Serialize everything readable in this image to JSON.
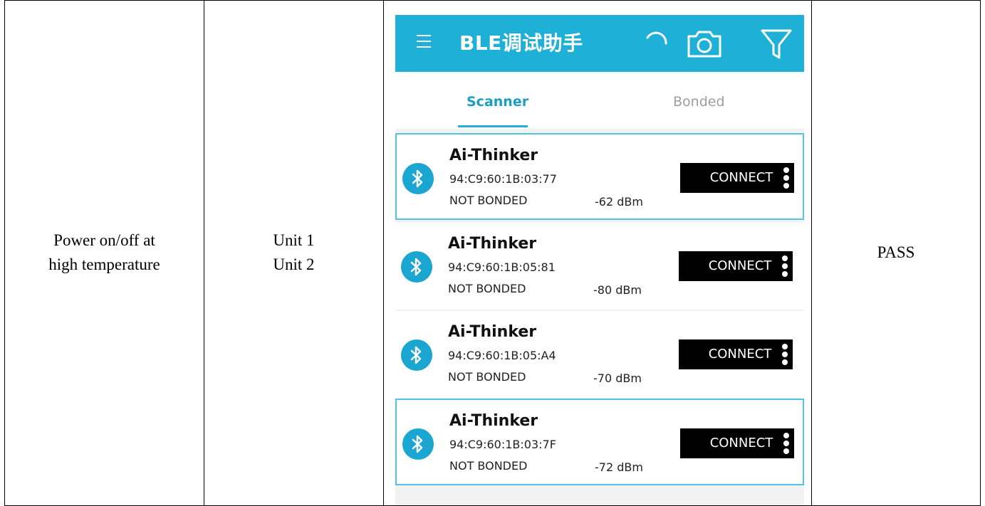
{
  "table": {
    "test_item": [
      "Power on/off at",
      "high temperature"
    ],
    "units": [
      "Unit 1",
      "Unit 2"
    ],
    "result": "PASS"
  },
  "app": {
    "title": "BLE调试助手",
    "header_icons": [
      "menu-icon",
      "refresh-icon",
      "camera-icon",
      "filter-icon"
    ],
    "accent_color": "#1fb0d7",
    "tabs": [
      {
        "label": "Scanner",
        "active": true
      },
      {
        "label": "Bonded",
        "active": false
      }
    ],
    "devices": [
      {
        "name": "Ai-Thinker",
        "mac": "94:C9:60:1B:03:77",
        "bond": "NOT BONDED",
        "rssi": "-62 dBm",
        "action": "CONNECT",
        "selected": true
      },
      {
        "name": "Ai-Thinker",
        "mac": "94:C9:60:1B:05:81",
        "bond": "NOT BONDED",
        "rssi": "-80 dBm",
        "action": "CONNECT",
        "selected": false
      },
      {
        "name": "Ai-Thinker",
        "mac": "94:C9:60:1B:05:A4",
        "bond": "NOT BONDED",
        "rssi": "-70 dBm",
        "action": "CONNECT",
        "selected": false
      },
      {
        "name": "Ai-Thinker",
        "mac": "94:C9:60:1B:03:7F",
        "bond": "NOT BONDED",
        "rssi": "-72 dBm",
        "action": "CONNECT",
        "selected": true
      }
    ]
  }
}
